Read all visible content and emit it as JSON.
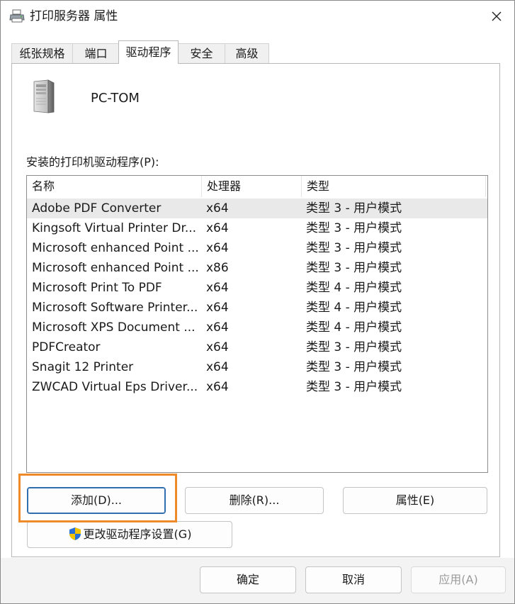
{
  "window": {
    "title": "打印服务器 属性",
    "icon": "printer-icon",
    "close_icon": "close-icon"
  },
  "tabs": [
    {
      "label": "纸张规格",
      "active": false
    },
    {
      "label": "端口",
      "active": false
    },
    {
      "label": "驱动程序",
      "active": true
    },
    {
      "label": "安全",
      "active": false
    },
    {
      "label": "高级",
      "active": false
    }
  ],
  "server": {
    "icon": "server-tower-icon",
    "name": "PC-TOM"
  },
  "drivers": {
    "label": "安装的打印机驱动程序(P):",
    "columns": [
      "名称",
      "处理器",
      "类型"
    ],
    "selected_index": 0,
    "rows": [
      {
        "name": "Adobe PDF Converter",
        "processor": "x64",
        "type": "类型 3 - 用户模式"
      },
      {
        "name": "Kingsoft Virtual Printer Dr...",
        "processor": "x64",
        "type": "类型 3 - 用户模式"
      },
      {
        "name": "Microsoft enhanced Point ...",
        "processor": "x64",
        "type": "类型 3 - 用户模式"
      },
      {
        "name": "Microsoft enhanced Point ...",
        "processor": "x86",
        "type": "类型 3 - 用户模式"
      },
      {
        "name": "Microsoft Print To PDF",
        "processor": "x64",
        "type": "类型 4 - 用户模式"
      },
      {
        "name": "Microsoft Software Printer...",
        "processor": "x64",
        "type": "类型 4 - 用户模式"
      },
      {
        "name": "Microsoft XPS Document ...",
        "processor": "x64",
        "type": "类型 4 - 用户模式"
      },
      {
        "name": "PDFCreator",
        "processor": "x64",
        "type": "类型 3 - 用户模式"
      },
      {
        "name": "Snagit 12 Printer",
        "processor": "x64",
        "type": "类型 3 - 用户模式"
      },
      {
        "name": "ZWCAD Virtual Eps Driver...",
        "processor": "x64",
        "type": "类型 3 - 用户模式"
      }
    ]
  },
  "actions": {
    "add": "添加(D)...",
    "remove": "删除(R)...",
    "properties": "属性(E)",
    "change_settings": "更改驱动程序设置(G)",
    "shield_icon": "uac-shield-icon"
  },
  "footer": {
    "ok": "确定",
    "cancel": "取消",
    "apply": "应用(A)",
    "apply_enabled": false
  },
  "colors": {
    "highlight": "#ef8a2a",
    "focus_border": "#2f6fb0",
    "selected_row": "#e9e9e9"
  }
}
